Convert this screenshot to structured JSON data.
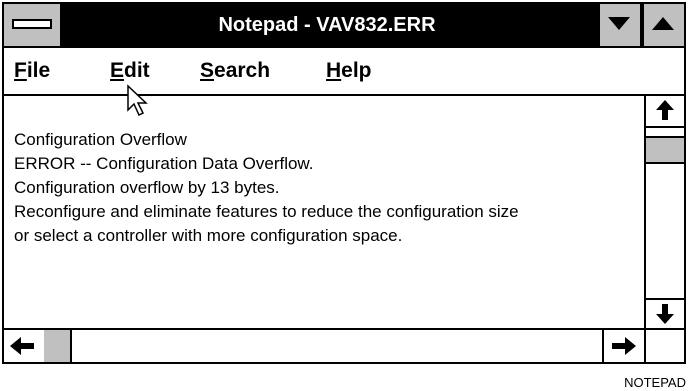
{
  "window": {
    "title": "Notepad - VAV832.ERR",
    "system_menu_icon": "system-menu-bar-icon",
    "minimize_icon": "triangle-down-icon",
    "maximize_icon": "triangle-up-icon"
  },
  "menu": {
    "items": [
      {
        "accel": "F",
        "rest": "ile"
      },
      {
        "accel": "E",
        "rest": "dit"
      },
      {
        "accel": "S",
        "rest": "earch"
      },
      {
        "accel": "H",
        "rest": "elp"
      }
    ]
  },
  "document": {
    "lines": [
      "Configuration Overflow",
      "ERROR -- Configuration Data Overflow.",
      "Configuration overflow by 13 bytes.",
      "Reconfigure and eliminate features to reduce the configuration size",
      "or select a controller with more configuration space."
    ]
  },
  "scrollbars": {
    "up_icon": "arrow-up-icon",
    "down_icon": "arrow-down-icon",
    "left_icon": "arrow-left-icon",
    "right_icon": "arrow-right-icon"
  },
  "cursor_icon": "mouse-pointer-icon",
  "caption": "NOTEPAD"
}
